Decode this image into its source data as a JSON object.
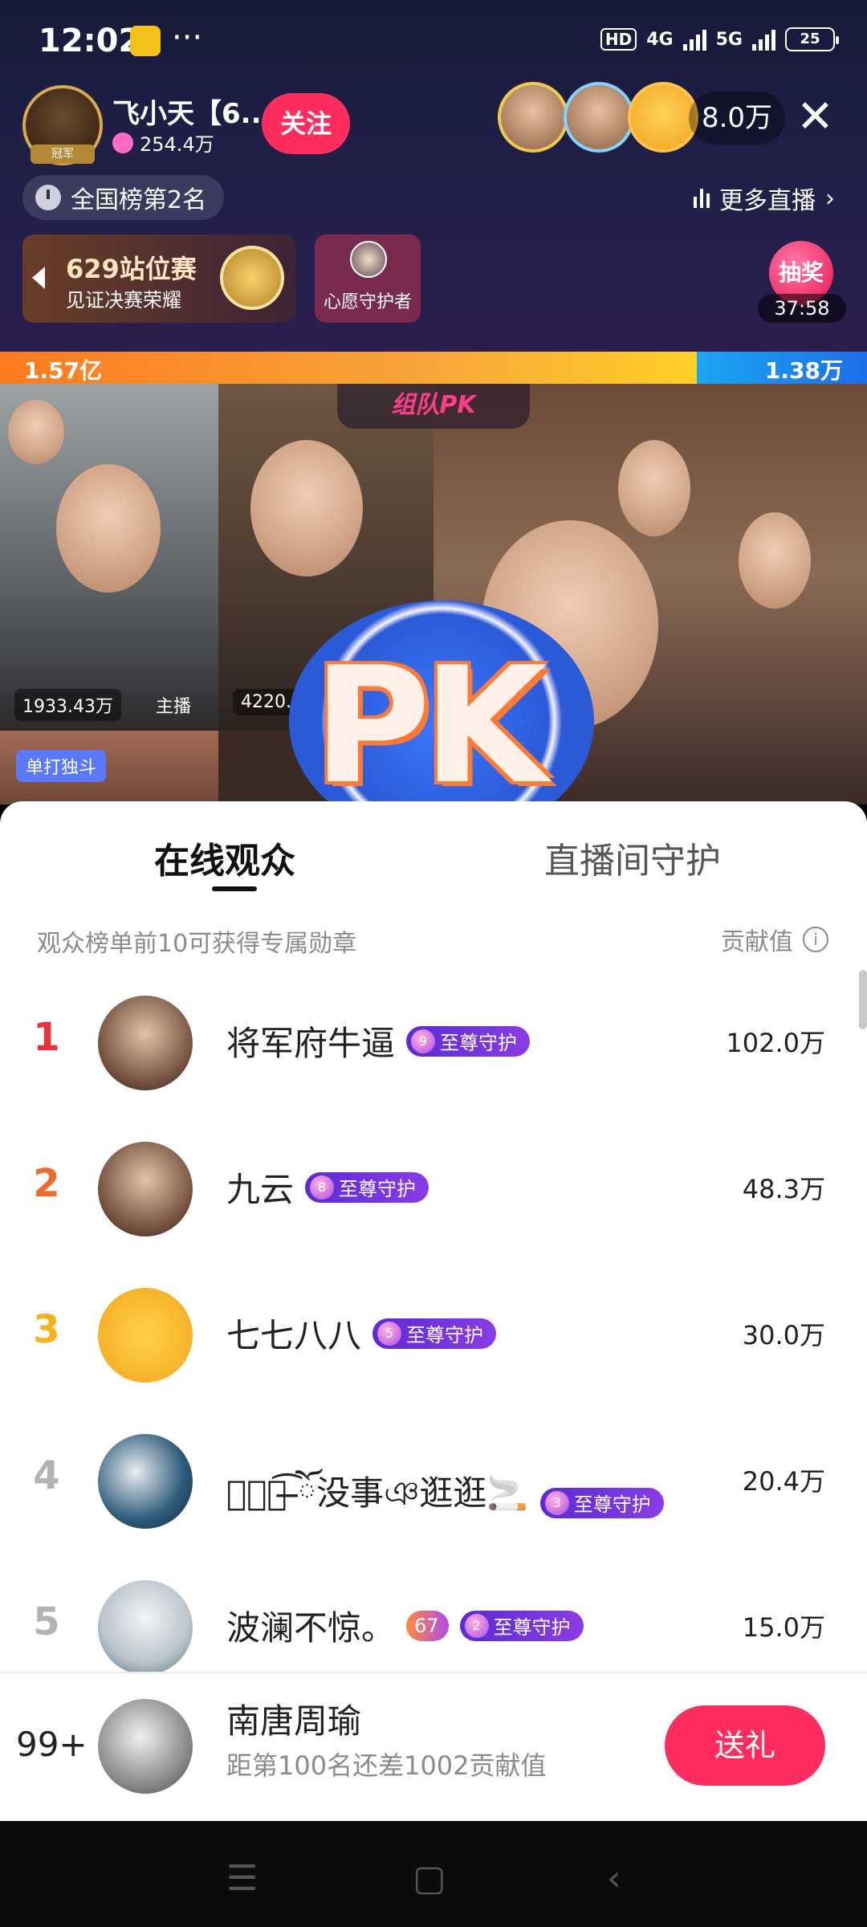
{
  "status_bar": {
    "time": "12:02",
    "dots": "···",
    "hd": "HD",
    "net1": "4G",
    "net2": "5G",
    "battery": "25"
  },
  "anchor": {
    "badge": "冠军",
    "name": "飞小天【6...",
    "fans": "254.4万",
    "follow_label": "关注"
  },
  "viewers": {
    "count": "8.0万",
    "close": "✕"
  },
  "rank_pill": "全国榜第2名",
  "more_live": "更多直播",
  "event": {
    "title": "629站位赛",
    "subtitle": "见证决赛荣耀"
  },
  "wish": {
    "label": "心愿守护者"
  },
  "lottery": {
    "label": "抽奖",
    "countdown": "37:58"
  },
  "pk_bar": {
    "left_value": "1.57亿",
    "right_value": "1.38万"
  },
  "video": {
    "pk_title": "组队PK",
    "tag1": "1933.43万",
    "tag2": "主播",
    "tag3": "4220.79",
    "solo_tag": "单打独斗",
    "pk_letters": "PK"
  },
  "sheet": {
    "tabs": [
      "在线观众",
      "直播间守护"
    ],
    "hint": "观众榜单前10可获得专属勋章",
    "contrib_header": "贡献值",
    "rows": [
      {
        "rank": "1",
        "name": "将军府牛逼",
        "badge_level": "9",
        "badge_label": "至尊守护",
        "value": "102.0万"
      },
      {
        "rank": "2",
        "name": "九云",
        "badge_level": "8",
        "badge_label": "至尊守护",
        "value": "48.3万"
      },
      {
        "rank": "3",
        "name": "七七八八",
        "badge_level": "5",
        "badge_label": "至尊守护",
        "value": "30.0万"
      },
      {
        "rank": "4",
        "name": "ঞ্ঁ͡ ̶ོ没事ঞ逛逛🚬",
        "badge_level": "3",
        "badge_label": "至尊守护",
        "value": "20.4万"
      },
      {
        "rank": "5",
        "name": "波澜不惊。",
        "lv": "67",
        "badge_level": "2",
        "badge_label": "至尊守护",
        "value": "15.0万"
      }
    ],
    "me": {
      "rank": "99+",
      "name": "南唐周瑜",
      "sub": "距第100名还差1002贡献值",
      "gift_label": "送礼"
    }
  },
  "colors": {
    "accent": "#ff2c5e",
    "rank1": "#e8323c",
    "rank2": "#f06a2a",
    "rank3": "#f5b319",
    "rank_other": "#b3b3b3",
    "badge": "#6a33dc"
  },
  "icons": [
    "app-icon",
    "clock-icon",
    "bar-chart-icon",
    "chevron-right-icon",
    "info-icon",
    "close-icon",
    "menu-icon",
    "home-icon",
    "back-icon"
  ]
}
